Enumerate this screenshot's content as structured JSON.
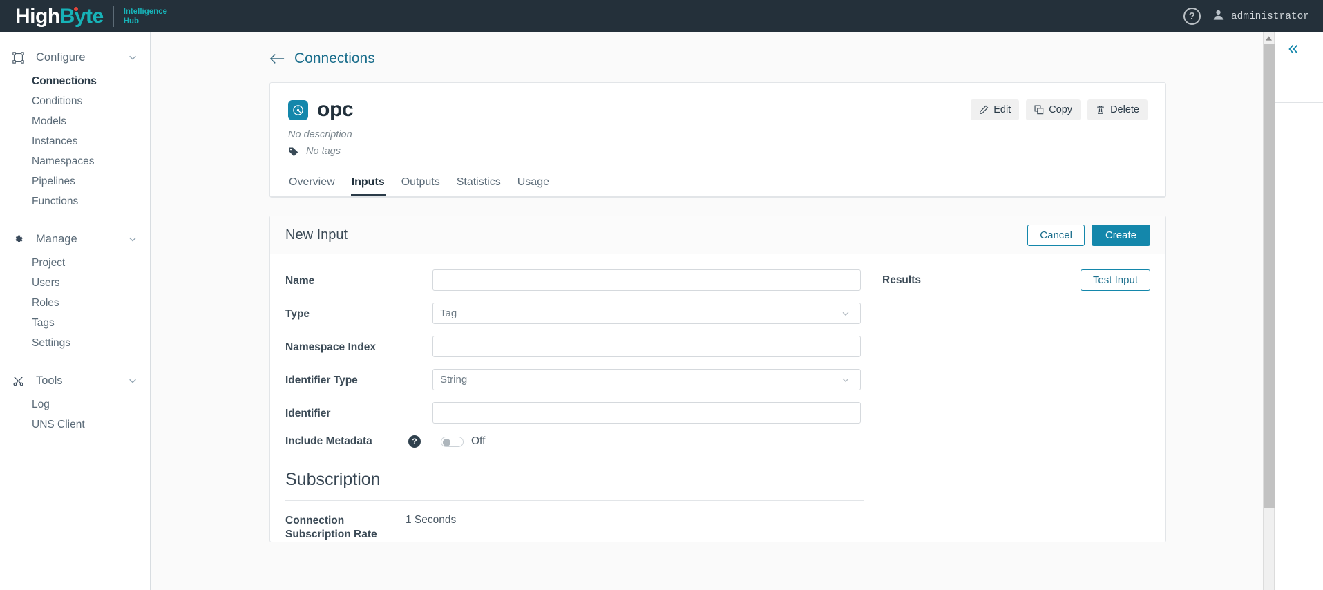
{
  "topbar": {
    "brand_high": "High",
    "brand_byte": "Byte",
    "product_line1": "Intelligence",
    "product_line2": "Hub",
    "help_glyph": "?",
    "user_name": "administrator",
    "help_icon": "question-circle-icon",
    "user_icon": "user-avatar-icon"
  },
  "sidebar": {
    "groups": [
      {
        "label": "Configure",
        "icon": "configure-nodes-icon",
        "items": [
          {
            "label": "Connections",
            "active": true
          },
          {
            "label": "Conditions",
            "active": false
          },
          {
            "label": "Models",
            "active": false
          },
          {
            "label": "Instances",
            "active": false
          },
          {
            "label": "Namespaces",
            "active": false
          },
          {
            "label": "Pipelines",
            "active": false
          },
          {
            "label": "Functions",
            "active": false
          }
        ]
      },
      {
        "label": "Manage",
        "icon": "gear-icon",
        "items": [
          {
            "label": "Project",
            "active": false
          },
          {
            "label": "Users",
            "active": false
          },
          {
            "label": "Roles",
            "active": false
          },
          {
            "label": "Tags",
            "active": false
          },
          {
            "label": "Settings",
            "active": false
          }
        ]
      },
      {
        "label": "Tools",
        "icon": "tools-icon",
        "items": [
          {
            "label": "Log",
            "active": false
          },
          {
            "label": "UNS Client",
            "active": false
          }
        ]
      }
    ]
  },
  "breadcrumb": {
    "back_label": "Connections",
    "back_icon": "arrow-left-icon"
  },
  "connection": {
    "name": "opc",
    "badge_icon": "connection-plug-icon",
    "description": "No description",
    "tags_text": "No tags",
    "tag_icon": "tag-icon",
    "actions": [
      {
        "label": "Edit",
        "icon": "pencil-icon"
      },
      {
        "label": "Copy",
        "icon": "copy-icon"
      },
      {
        "label": "Delete",
        "icon": "trash-icon"
      }
    ],
    "tabs": [
      {
        "label": "Overview",
        "active": false
      },
      {
        "label": "Inputs",
        "active": true
      },
      {
        "label": "Outputs",
        "active": false
      },
      {
        "label": "Statistics",
        "active": false
      },
      {
        "label": "Usage",
        "active": false
      }
    ]
  },
  "new_input": {
    "title": "New Input",
    "cancel_label": "Cancel",
    "create_label": "Create",
    "fields": {
      "name": {
        "label": "Name",
        "value": "",
        "placeholder": ""
      },
      "type": {
        "label": "Type",
        "value": "Tag"
      },
      "namespace_index": {
        "label": "Namespace Index",
        "value": "",
        "placeholder": ""
      },
      "identifier_type": {
        "label": "Identifier Type",
        "value": "String"
      },
      "identifier": {
        "label": "Identifier",
        "value": "",
        "placeholder": ""
      },
      "include_metadata": {
        "label": "Include Metadata",
        "help_glyph": "?",
        "toggle_state": "Off"
      }
    },
    "results": {
      "label": "Results",
      "test_button": "Test Input"
    },
    "subscription": {
      "title": "Subscription",
      "rate_label_line1": "Connection",
      "rate_label_line2": "Subscription Rate",
      "rate_value": "1 Seconds"
    }
  },
  "right_rail": {
    "collapse_icon": "chevron-double-left-icon"
  },
  "colors": {
    "brand_teal": "#17b3b8",
    "accent_teal": "#1487ab",
    "topbar_bg": "#24303a",
    "link_blue": "#1b6e8c",
    "dot_red": "#e2453a"
  }
}
